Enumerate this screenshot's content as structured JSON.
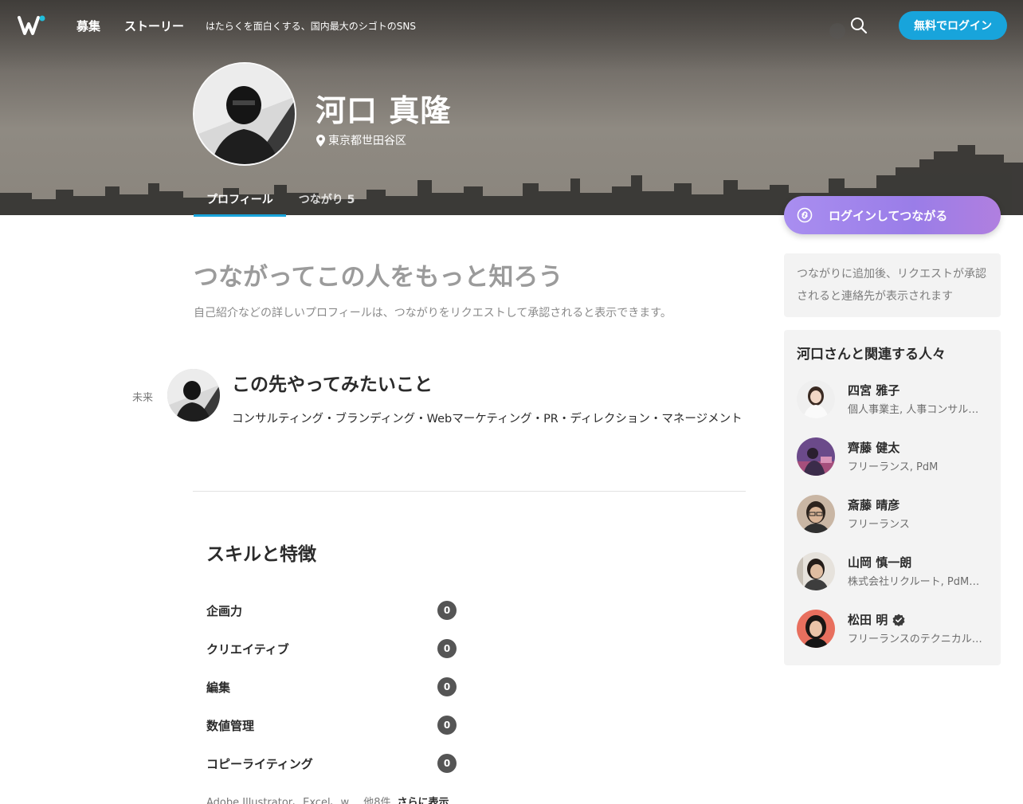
{
  "nav": {
    "links": [
      "募集",
      "ストーリー"
    ],
    "tagline": "はたらくを面白くする、国内最大のシゴトのSNS",
    "login_label": "無料でログイン"
  },
  "profile": {
    "name": "河口 真隆",
    "location": "東京都世田谷区",
    "tabs": [
      {
        "label": "プロフィール",
        "active": true
      },
      {
        "label": "つながり 5",
        "active": false
      }
    ]
  },
  "main": {
    "headline": "つながってこの人をもっと知ろう",
    "subline": "自己紹介などの詳しいプロフィールは、つながりをリクエストして承認されると表示できます。",
    "future": {
      "label": "未来",
      "title": "この先やってみたいこと",
      "body": "コンサルティング・ブランディング・Webマーケティング・PR・ディレクション・マネージメント"
    },
    "skills": {
      "title": "スキルと特徴",
      "items": [
        {
          "name": "企画力",
          "count": "0"
        },
        {
          "name": "クリエイティブ",
          "count": "0"
        },
        {
          "name": "編集",
          "count": "0"
        },
        {
          "name": "数値管理",
          "count": "0"
        },
        {
          "name": "コピーライティング",
          "count": "0"
        }
      ],
      "more_text": "Adobe Illustrator、Excel、w",
      "more_count": "他8件",
      "more_link": "さらに表示"
    }
  },
  "sidebar": {
    "connect_label": "ログインしてつながる",
    "info": "つながりに追加後、リクエストが承認されると連絡先が表示されます",
    "related_title": "河口さんと関連する人々",
    "people": [
      {
        "name": "四宮 雅子",
        "role": "個人事業主, 人事コンサルタント",
        "verified": false
      },
      {
        "name": "齊藤 健太",
        "role": "フリーランス, PdM",
        "verified": false
      },
      {
        "name": "斎藤 晴彦",
        "role": "フリーランス",
        "verified": false
      },
      {
        "name": "山岡 慎一朗",
        "role": "株式会社リクルート, PdM（プロダクトマネージャー）",
        "verified": false
      },
      {
        "name": "松田 明",
        "role": "フリーランスのテクニカルライター",
        "verified": true
      }
    ]
  },
  "colors": {
    "accent": "#18a4db",
    "connect_gradient_start": "#a98ef0",
    "connect_gradient_end": "#b07fdf",
    "badge": "#555555"
  },
  "icons": [
    "wantedly-logo-icon",
    "search-icon",
    "map-pin-icon",
    "link-icon",
    "verified-icon"
  ]
}
